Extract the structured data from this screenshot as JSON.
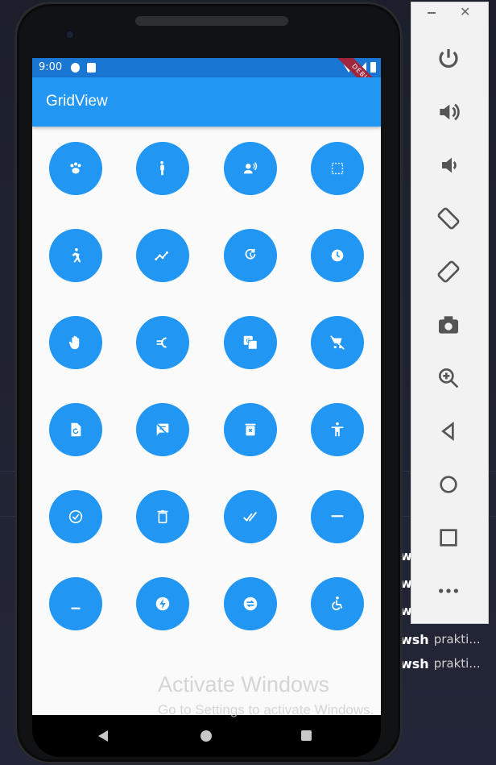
{
  "app": {
    "title": "GridView"
  },
  "status": {
    "time": "9:00",
    "ribbon": "DEBUG"
  },
  "icons": [
    "pets-icon",
    "pregnant-woman-icon",
    "record-voice-icon",
    "crop-free-icon",
    "directions-run-icon",
    "timeline-icon",
    "update-icon",
    "schedule-icon",
    "pan-tool-icon",
    "euro-icon",
    "g-translate-icon",
    "remove-shopping-cart-icon",
    "restore-page-icon",
    "speaker-notes-off-icon",
    "delete-forever-icon",
    "accessibility-icon",
    "check-circle-icon",
    "delete-icon",
    "done-all-icon",
    "remove-icon",
    "minimize-icon",
    "offline-bolt-icon",
    "swap-horizontal-icon",
    "accessible-icon"
  ],
  "toolbar": {
    "items": [
      "power-icon",
      "volume-up-icon",
      "volume-down-icon",
      "rotate-left-icon",
      "rotate-right-icon",
      "camera-icon",
      "zoom-in-icon",
      "back-icon",
      "home-icon",
      "overview-icon",
      "more-icon"
    ]
  },
  "watermark": {
    "line1": "Activate Windows",
    "line2": "Go to Settings to activate Windows."
  },
  "terminal": {
    "rows": [
      {
        "shell": "w",
        "label": ""
      },
      {
        "shell": "w",
        "label": ""
      },
      {
        "shell": "w",
        "label": ""
      },
      {
        "shell": "wsh",
        "label": "prakti..."
      },
      {
        "shell": "wsh",
        "label": "prakti..."
      }
    ]
  },
  "colors": {
    "primary": "#2196f3",
    "statusbar": "#1976d2"
  }
}
